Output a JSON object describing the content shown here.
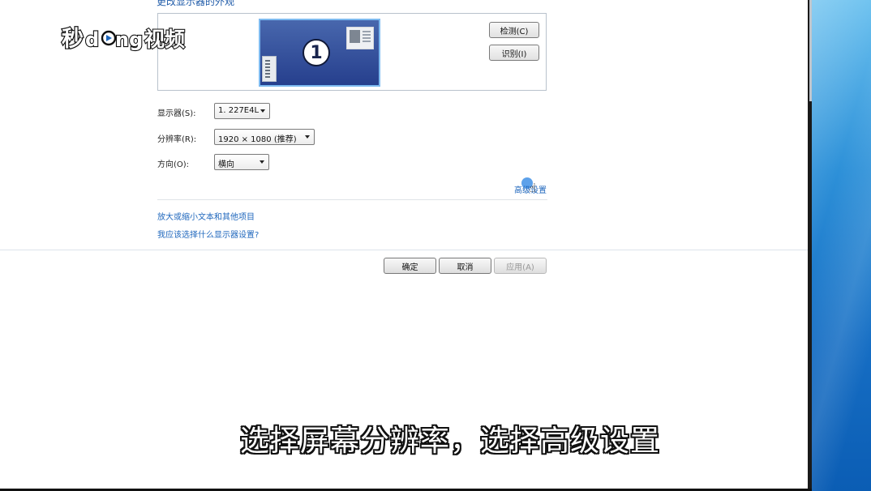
{
  "page": {
    "heading": "更改显示器的外观",
    "monitor_number": "1"
  },
  "buttons": {
    "detect": "检测(C)",
    "identify": "识别(I)",
    "ok": "确定",
    "cancel": "取消",
    "apply": "应用(A)"
  },
  "form": {
    "display_label": "显示器(S):",
    "display_value": "1. 227E4L",
    "resolution_label": "分辨率(R):",
    "resolution_value": "1920 × 1080 (推荐)",
    "orientation_label": "方向(O):",
    "orientation_value": "横向"
  },
  "links": {
    "advanced": "高级设置",
    "enlarge_text": "放大或缩小文本和其他项目",
    "which_settings": "我应该选择什么显示器设置?"
  },
  "overlay": {
    "watermark": "秒dong视频",
    "caption": "选择屏幕分辨率，选择高级设置"
  },
  "colors": {
    "link": "#1f67bd",
    "monitor_tile": "#3651a0",
    "desktop": "#2d90d8"
  },
  "icons": {
    "pointer": "hand-cursor-icon",
    "dropdown": "chevron-down-icon"
  }
}
